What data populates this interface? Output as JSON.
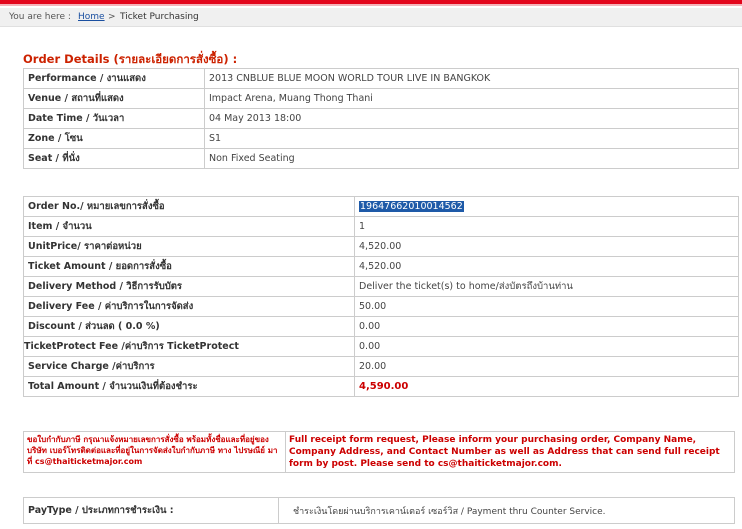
{
  "breadcrumb": {
    "prefix": "You are here :",
    "home": "Home",
    "separator": ">",
    "current": "Ticket Purchasing"
  },
  "heading": "Order Details (รายละเอียดการสั่งซื้อ) :",
  "performance_details": [
    {
      "label": "Performance / งานแสดง",
      "value": "2013 CNBLUE BLUE MOON WORLD TOUR LIVE IN BANGKOK"
    },
    {
      "label": "Venue / สถานที่แสดง",
      "value": "Impact Arena, Muang Thong Thani"
    },
    {
      "label": "Date Time / วันเวลา",
      "value": "04 May 2013 18:00"
    },
    {
      "label": "Zone / โซน",
      "value": "S1"
    },
    {
      "label": "Seat / ที่นั่ง",
      "value": "Non Fixed Seating"
    }
  ],
  "order": {
    "order_no": {
      "label": "Order No./ หมายเลขการสั่งซื้อ",
      "value": "19647662010014562"
    },
    "item": {
      "label": "Item / จำนวน",
      "value": "1"
    },
    "unit_price": {
      "label": "UnitPrice/ ราคาต่อหน่วย",
      "value": "4,520.00"
    },
    "ticket_amount": {
      "label": "Ticket Amount / ยอดการสั่งซื้อ",
      "value": "4,520.00"
    },
    "delivery_method": {
      "label": "Delivery Method / วิธีการรับบัตร",
      "value": "Deliver the ticket(s) to home/ส่งบัตรถึงบ้านท่าน"
    },
    "delivery_fee": {
      "label": "Delivery Fee / ค่าบริการในการจัดส่ง",
      "value": "50.00"
    },
    "discount": {
      "label": "Discount / ส่วนลด ( 0.0 %)",
      "value": "0.00"
    },
    "ticket_protect": {
      "label": "TicketProtect Fee /ค่าบริการ TicketProtect",
      "value": "0.00"
    },
    "service_charge": {
      "label": "Service Charge /ค่าบริการ",
      "value": "20.00"
    },
    "total_amount": {
      "label": "Total Amount / จำนวนเงินที่ต้องชำระ",
      "value": "4,590.00"
    }
  },
  "notice": {
    "thai": "ขอใบกำกับภาษี กรุณาแจ้งหมายเลขการสั่งซื้อ พร้อมทั้งชื่อและที่อยู่ของบริษัท เบอร์โทรติดต่อและที่อยู่ในการจัดส่งใบกำกับภาษี ทาง ไปรษณีย์ มาที่ cs@thaiticketmajor.com",
    "english": "Full receipt form request, Please inform your purchasing order, Company Name, Company Address, and Contact Number as well as Address that can send full receipt form by post. Please send to cs@thaiticketmajor.com."
  },
  "paytype": {
    "label": "PayType / ประเภทการชำระเงิน :",
    "value": "ชำระเงินโดยผ่านบริการเคาน์เตอร์ เซอร์วิส / Payment thru Counter Service."
  },
  "colors": {
    "accent_red": "#e3051b",
    "heading_red": "#cc2200",
    "selection_blue": "#1e5aa8"
  }
}
